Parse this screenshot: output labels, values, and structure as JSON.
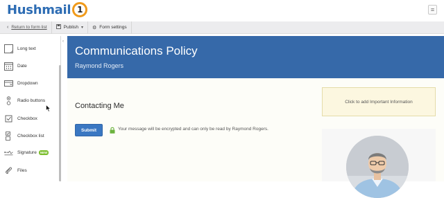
{
  "app": {
    "logo_text": "Hushmail",
    "logo_badge": "1"
  },
  "header": {
    "menu_icon": "menu-icon"
  },
  "toolbar": {
    "back_label": "Return to form list",
    "publish_label": "Publish",
    "settings_label": "Form settings"
  },
  "sidebar": {
    "items": [
      {
        "label": "Long text",
        "icon": "long-text-icon"
      },
      {
        "label": "Date",
        "icon": "calendar-icon"
      },
      {
        "label": "Dropdown",
        "icon": "dropdown-icon"
      },
      {
        "label": "Radio buttons",
        "icon": "radio-icon"
      },
      {
        "label": "Checkbox",
        "icon": "checkbox-icon"
      },
      {
        "label": "Checkbox list",
        "icon": "checkbox-list-icon"
      },
      {
        "label": "Signature",
        "icon": "signature-icon",
        "badge": "NEW"
      },
      {
        "label": "Files",
        "icon": "paperclip-icon"
      }
    ]
  },
  "form": {
    "title": "Communications Policy",
    "subtitle": "Raymond Rogers",
    "section_title": "Contacting Me",
    "submit_label": "Submit",
    "encryption_notice": "Your message will be encrypted and can only be read by Raymond Rogers.",
    "info_box_label": "Click to add Important Information"
  },
  "colors": {
    "brand_blue": "#3669a9",
    "submit_blue": "#3a77c2",
    "logo_orange": "#f09a1a",
    "new_badge_green": "#7cbe2e",
    "lock_green": "#6cb33f"
  }
}
